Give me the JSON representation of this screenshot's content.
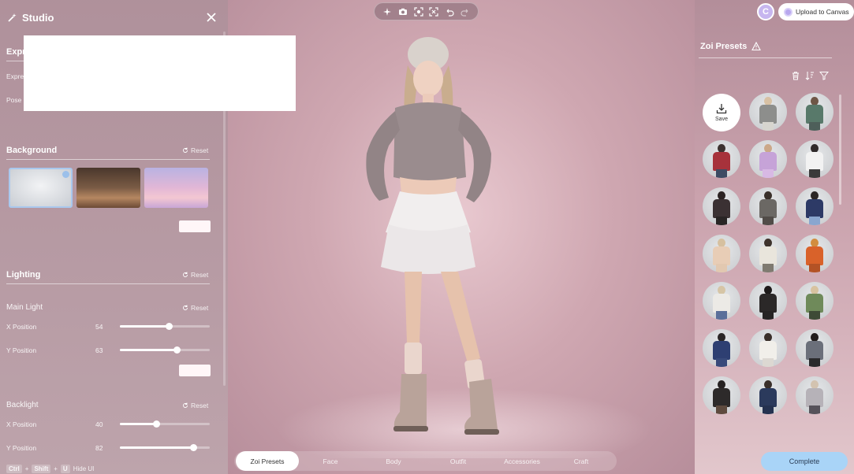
{
  "toolbar": {
    "icons": [
      "magic-sparkle-icon",
      "camera-icon",
      "frame-icon",
      "focus-icon",
      "undo-icon",
      "redo-icon"
    ]
  },
  "top_right": {
    "profile_initial": "C",
    "upload_label": "Upload to Canvas"
  },
  "left_panel": {
    "title": "Studio",
    "expression_section": {
      "title": "Expr",
      "row1": "Expre",
      "row2": "Pose"
    },
    "background": {
      "title": "Background",
      "reset": "Reset",
      "thumbnails": [
        "studio-gray",
        "cozy-room",
        "pink-clouds"
      ],
      "selected": 0
    },
    "lighting": {
      "title": "Lighting",
      "reset": "Reset",
      "main_light": {
        "title": "Main Light",
        "reset": "Reset",
        "x_label": "X Position",
        "x_value": "54",
        "y_label": "Y Position",
        "y_value": "63"
      },
      "backlight": {
        "title": "Backlight",
        "reset": "Reset",
        "x_label": "X Position",
        "x_value": "40",
        "y_label": "Y Position",
        "y_value": "82"
      }
    },
    "hotkeys": {
      "k1": "Ctrl",
      "plus1": "+",
      "k2": "Shift",
      "plus2": "+",
      "k3": "U",
      "label": "Hide UI"
    }
  },
  "right_panel": {
    "title": "Zoi Presets",
    "save_label": "Save",
    "preset_count": 20
  },
  "bottom": {
    "tabs": [
      "Zoi Presets",
      "Face",
      "Body",
      "Outfit",
      "Accessories",
      "Craft"
    ],
    "active_tab": 0,
    "complete_label": "Complete"
  },
  "colors": {
    "accent": "#a9d4f7",
    "panel": "#b0909b",
    "backdrop": "#cfa7b1"
  }
}
